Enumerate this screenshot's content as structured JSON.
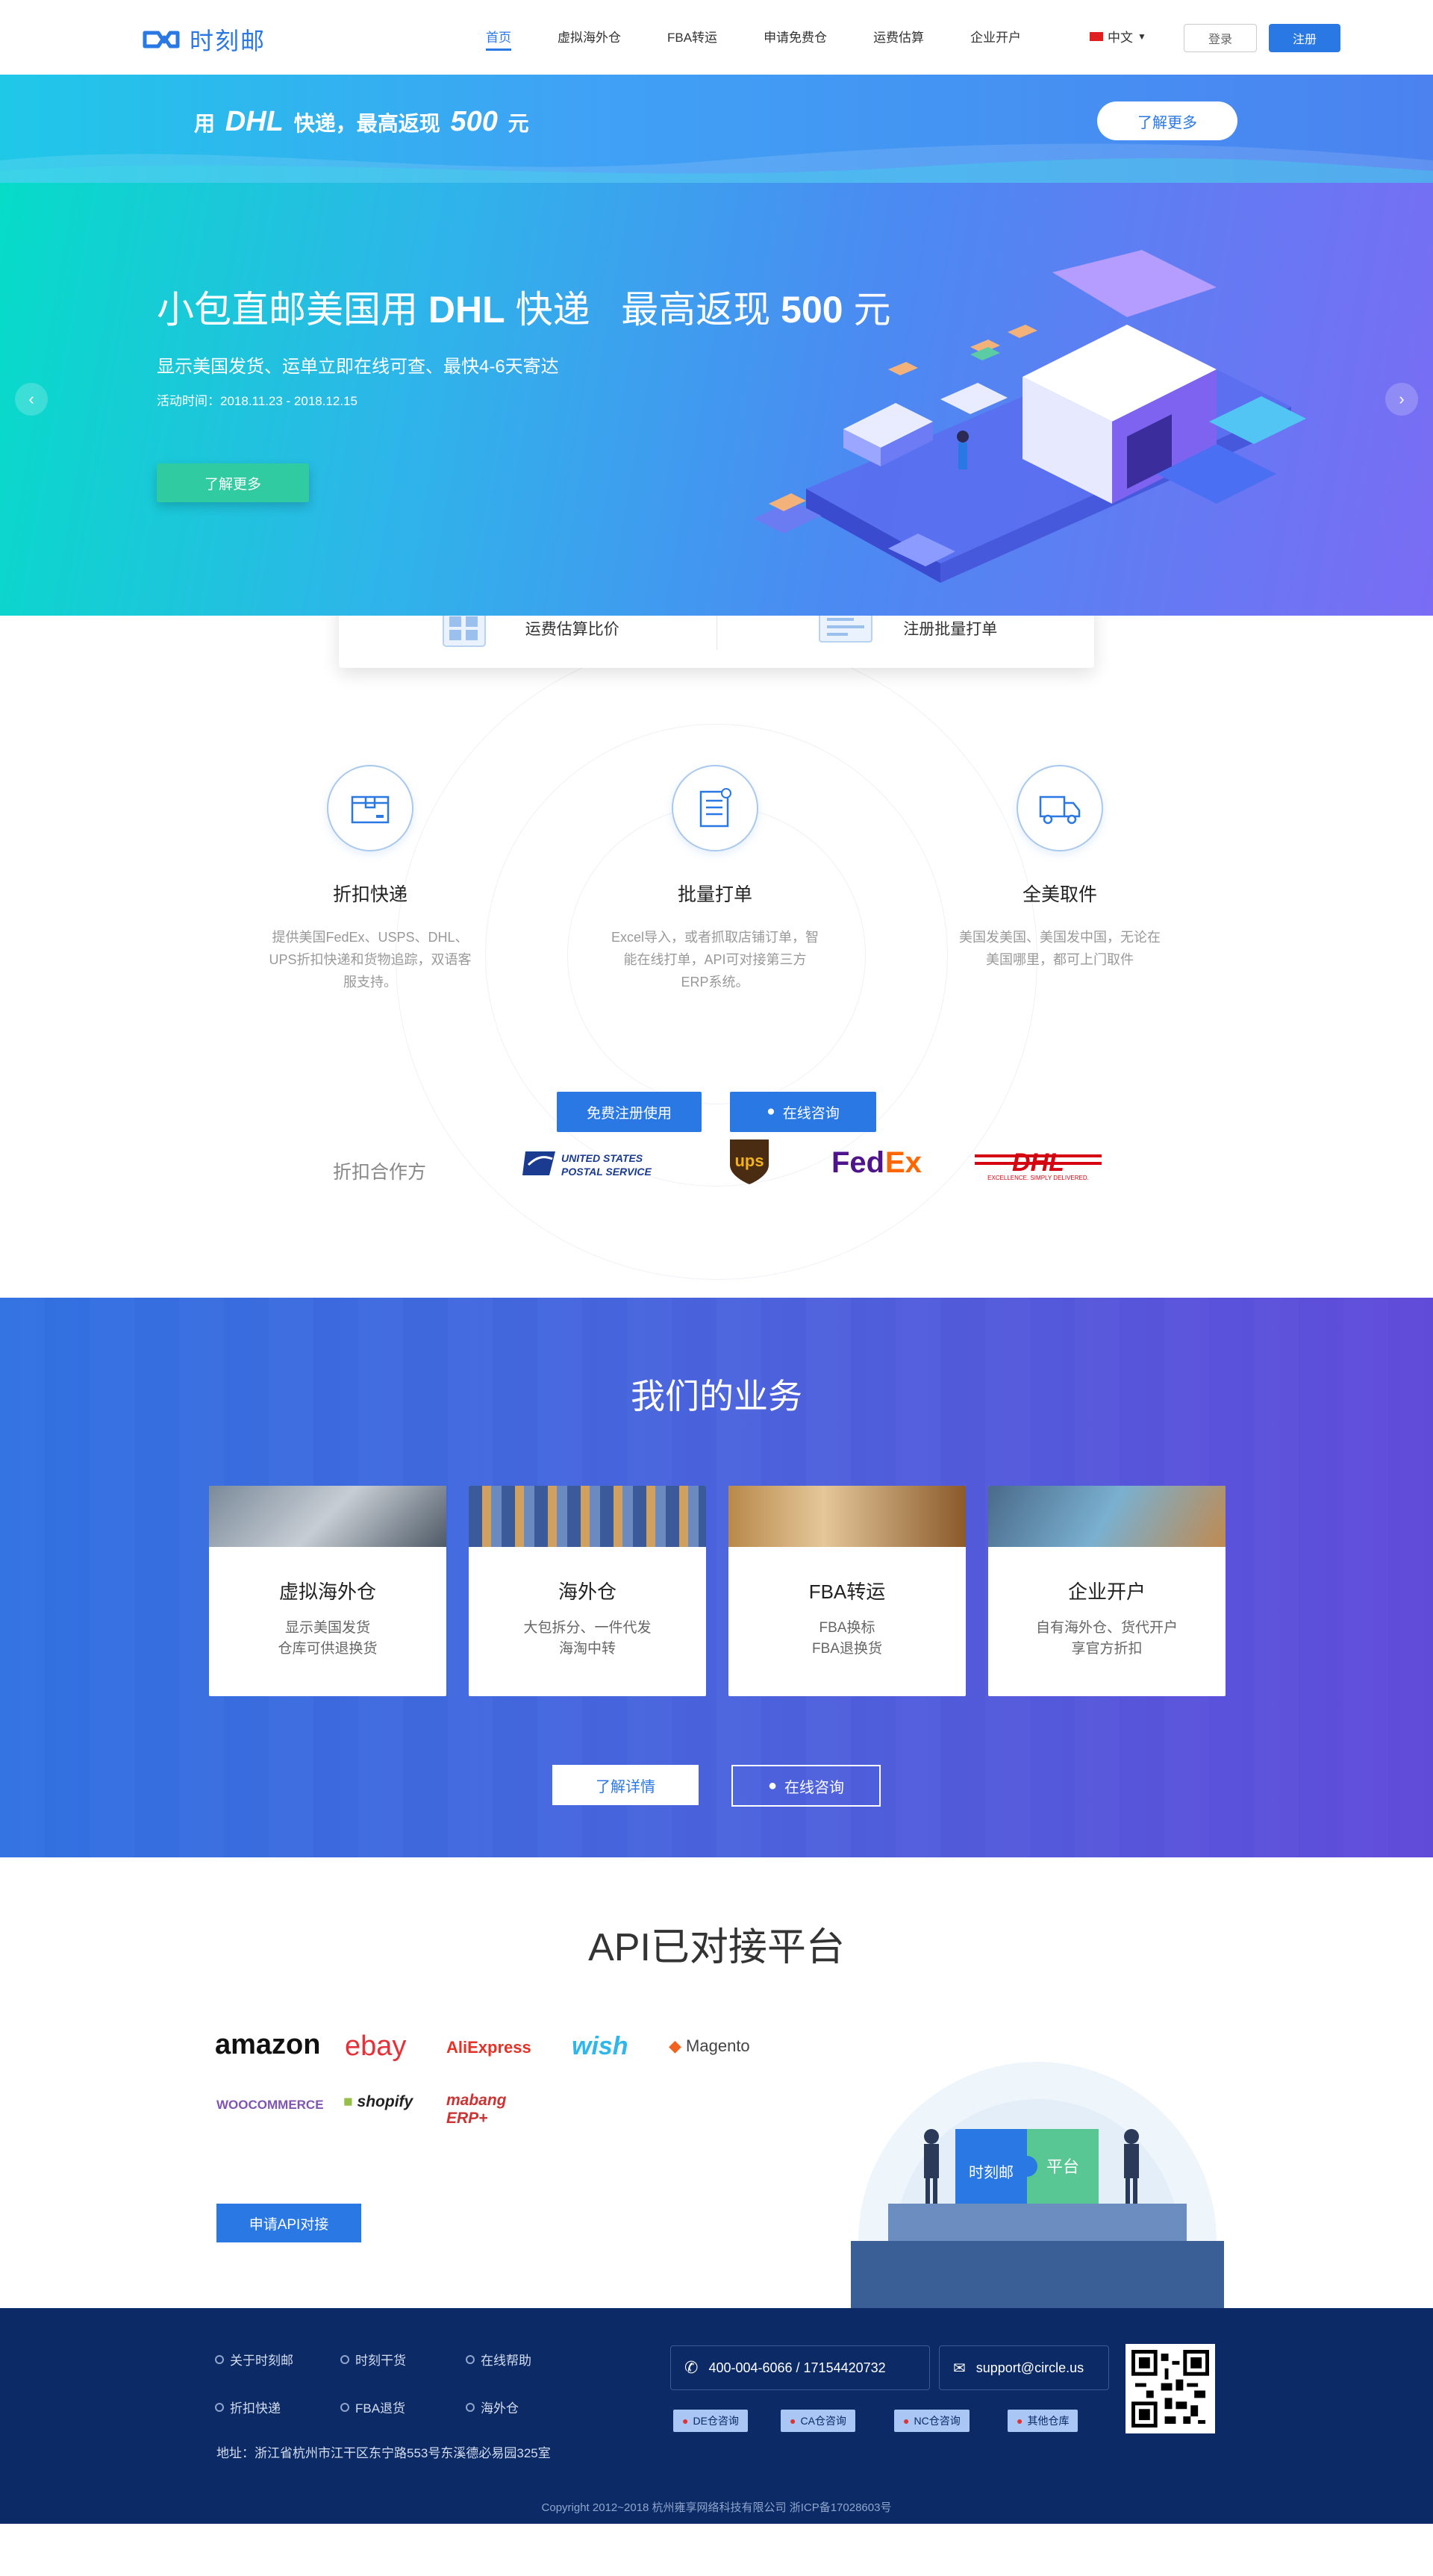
{
  "header": {
    "logo_text": "时刻邮",
    "nav": [
      "首页",
      "虚拟海外仓",
      "FBA转运",
      "申请免费仓",
      "运费估算",
      "企业开户"
    ],
    "language": "中文",
    "login": "登录",
    "register": "注册"
  },
  "promo": {
    "prefix": "用",
    "brand": "DHL",
    "middle": "快递，最高返现",
    "amount": "500",
    "suffix": "元",
    "button": "了解更多"
  },
  "hero": {
    "title_part1": "小包直邮美国用",
    "title_brand": "DHL",
    "title_part2": "快递",
    "title_part3": "最高返现",
    "title_amount": "500",
    "title_part4": "元",
    "subtitle": "显示美国发货、运单立即在线可查、最快4-6天寄达",
    "date": "活动时间：2018.11.23 - 2018.12.15",
    "button": "了解更多"
  },
  "quick": {
    "items": [
      "运费估算比价",
      "注册批量打单"
    ]
  },
  "features": {
    "items": [
      {
        "title": "折扣快递",
        "desc": "提供美国FedEx、USPS、DHL、UPS折扣快递和货物追踪，双语客服支持。"
      },
      {
        "title": "批量打单",
        "desc": "Excel导入，或者抓取店铺订单，智能在线打单，API可对接第三方ERP系统。"
      },
      {
        "title": "全美取件",
        "desc": "美国发美国、美国发中国，无论在美国哪里，都可上门取件"
      }
    ],
    "register_button": "免费注册使用",
    "consult_button": "在线咨询",
    "partners_label": "折扣合作方",
    "partners": [
      "UNITED STATES POSTAL SERVICE",
      "ups",
      "FedEx",
      "DHL"
    ]
  },
  "business": {
    "title": "我们的业务",
    "cards": [
      {
        "name": "虚拟海外仓",
        "line1": "显示美国发货",
        "line2": "仓库可供退换货"
      },
      {
        "name": "海外仓",
        "line1": "大包拆分、一件代发",
        "line2": "海淘中转"
      },
      {
        "name": "FBA转运",
        "line1": "FBA换标",
        "line2": "FBA退换货"
      },
      {
        "name": "企业开户",
        "line1": "自有海外仓、货代开户",
        "line2": "享官方折扣"
      }
    ],
    "details_button": "了解详情",
    "consult_button": "在线咨询"
  },
  "api": {
    "title": "API已对接平台",
    "brands": [
      "amazon",
      "ebay",
      "AliExpress",
      "wish",
      "Magento",
      "WOOCOMMERCE",
      "shopify",
      "mabang ERP+"
    ],
    "button": "申请API对接",
    "illus_logo": "时刻邮",
    "illus_platform": "平台"
  },
  "footer": {
    "links": [
      "关于时刻邮",
      "时刻干货",
      "在线帮助",
      "折扣快递",
      "FBA退货",
      "海外仓"
    ],
    "address": "地址：浙江省杭州市江干区东宁路553号东溪德必易园325室",
    "phone": "400-004-6066 / 17154420732",
    "email": "support@circle.us",
    "warehouses": [
      "DE仓咨询",
      "CA仓咨询",
      "NC仓咨询",
      "其他仓库"
    ],
    "copyright": "Copyright 2012~2018 杭州雍享网络科技有限公司 浙ICP备17028603号"
  },
  "colors": {
    "brand_blue": "#2a78e4",
    "hero_green": "#30cba0",
    "footer_navy": "#0b2a66"
  }
}
